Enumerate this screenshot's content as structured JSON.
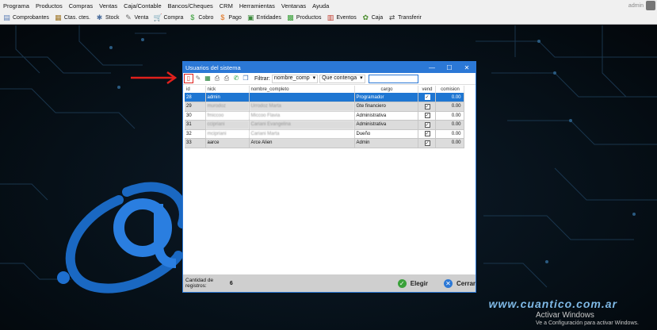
{
  "menu": [
    "Programa",
    "Productos",
    "Compras",
    "Ventas",
    "Caja/Contable",
    "Bancos/Cheques",
    "CRM",
    "Herramientas",
    "Ventanas",
    "Ayuda"
  ],
  "user": "admin",
  "toolbar": [
    {
      "label": "Comprobantes",
      "icon": "document-icon",
      "glyph": "▤",
      "color": "#5a7db5"
    },
    {
      "label": "Ctas. ctes.",
      "icon": "accounts-icon",
      "glyph": "▦",
      "color": "#a0782b"
    },
    {
      "label": "Stock",
      "icon": "stock-icon",
      "glyph": "✱",
      "color": "#4d6f9e"
    },
    {
      "label": "Venta",
      "icon": "sale-icon",
      "glyph": "✎",
      "color": "#6a6a6a"
    },
    {
      "label": "Compra",
      "icon": "cart-icon",
      "glyph": "🛒",
      "color": "#2a6fd0"
    },
    {
      "label": "Cobro",
      "icon": "collect-money-icon",
      "glyph": "$",
      "color": "#2c9a2c"
    },
    {
      "label": "Pago",
      "icon": "pay-money-icon",
      "glyph": "$",
      "color": "#e06a10"
    },
    {
      "label": "Entidades",
      "icon": "entities-icon",
      "glyph": "▣",
      "color": "#3b8a3b"
    },
    {
      "label": "Productos",
      "icon": "products-icon",
      "glyph": "▩",
      "color": "#3aa13a"
    },
    {
      "label": "Eventos",
      "icon": "events-icon",
      "glyph": "▥",
      "color": "#c0392b"
    },
    {
      "label": "Caja",
      "icon": "cashbox-icon",
      "glyph": "✿",
      "color": "#4a8c2c"
    },
    {
      "label": "Transferir",
      "icon": "transfer-icon",
      "glyph": "⇄",
      "color": "#444"
    }
  ],
  "window": {
    "title": "Usuarios del sistema",
    "controls": [
      "—",
      "☐",
      "✕"
    ],
    "filter_label": "Filtrar:",
    "filter_field": "nombre_comp",
    "filter_mode": "Que contenga",
    "search_value": ""
  },
  "columns": [
    "id",
    "nick",
    "nombre_completo",
    "cargo",
    "vend",
    "comision"
  ],
  "rows": [
    {
      "id": "28",
      "nick": "admin",
      "nombre": "",
      "cargo": "Programador",
      "vend": true,
      "comision": "0.00",
      "selected": true
    },
    {
      "id": "29",
      "nick": "murodoz",
      "nombre": "Urrodoz Marta",
      "cargo": "Gte financiero",
      "vend": true,
      "comision": "0.00"
    },
    {
      "id": "30",
      "nick": "fmiccoo",
      "nombre": "Miccoo Flavia",
      "cargo": "Administrativa",
      "vend": true,
      "comision": "0.00"
    },
    {
      "id": "31",
      "nick": "ccipriani",
      "nombre": "Cariani Evangelina",
      "cargo": "Administrativa",
      "vend": true,
      "comision": "0.00"
    },
    {
      "id": "32",
      "nick": "mcipriani",
      "nombre": "Cariani Marta",
      "cargo": "Dueño",
      "vend": true,
      "comision": "0.00"
    },
    {
      "id": "33",
      "nick": "aarce",
      "nombre": "Arce Alien",
      "cargo": "Admin",
      "vend": true,
      "comision": "0.00"
    }
  ],
  "footer": {
    "count_label": "Cantidad de registros:",
    "count_value": "6",
    "select_label": "Elegir",
    "close_label": "Cerrar"
  },
  "brand": "www.cuantico.com.ar",
  "activate": {
    "line1": "Activar Windows",
    "line2": "Ve a Configuración para activar Windows."
  },
  "colors": {
    "accent": "#2b78d6",
    "row_selected": "#1e76d2",
    "arrow": "#e0201c"
  }
}
